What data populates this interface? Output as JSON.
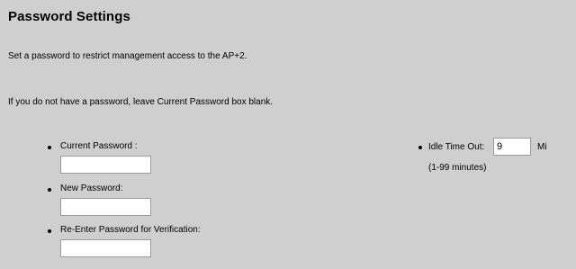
{
  "title": "Password Settings",
  "intro": "Set a password to restrict management access to the AP+2.",
  "note": "If you do not have a password, leave Current Password box blank.",
  "fields": [
    {
      "label": "Current Password :",
      "value": ""
    },
    {
      "label": "New Password:",
      "value": ""
    },
    {
      "label": "Re-Enter Password for Verification:",
      "value": ""
    }
  ],
  "idle": {
    "label": "Idle Time Out:",
    "value": "9",
    "unit": "Mi",
    "range": "(1-99 minutes)"
  }
}
